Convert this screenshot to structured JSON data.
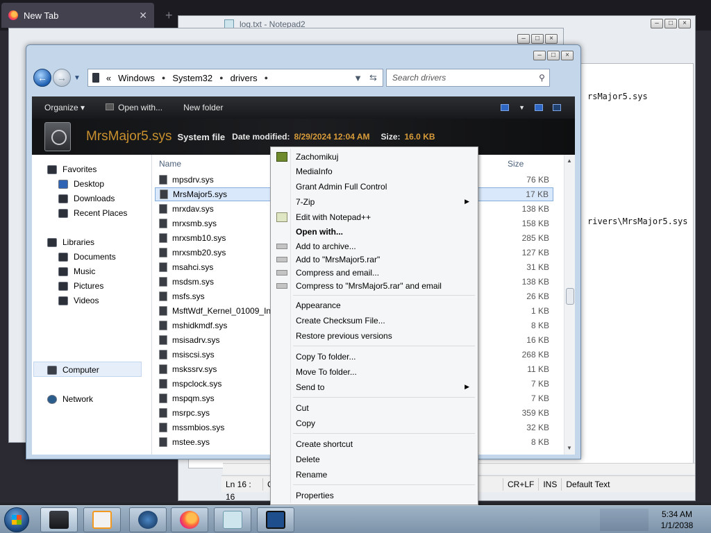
{
  "browser": {
    "tab_title": "New Tab",
    "tab_close": "✕",
    "new_tab": "+"
  },
  "notepad": {
    "title": "log.txt - Notepad2",
    "lines": [
      "rsMajor5.sys",
      "rivers\\MrsMajor5.sys"
    ],
    "status": {
      "position": "Ln 16 : 16",
      "col_partial": "C",
      "eol": "CR+LF",
      "ins": "INS",
      "scheme": "Default Text"
    }
  },
  "explorer": {
    "breadcrumb": [
      "Windows",
      "System32",
      "drivers"
    ],
    "crumb_prefix": "«",
    "search_placeholder": "Search drivers",
    "toolbar": {
      "organize": "Organize",
      "open_with": "Open with...",
      "new_folder": "New folder"
    },
    "details": {
      "filename": "MrsMajor5.sys",
      "filetype": "System file",
      "date_label": "Date modified:",
      "date_value": "8/29/2024 12:04 AM",
      "size_label": "Size:",
      "size_value": "16.0 KB"
    },
    "nav": {
      "favorites": "Favorites",
      "desktop": "Desktop",
      "downloads": "Downloads",
      "recent_places": "Recent Places",
      "libraries": "Libraries",
      "documents": "Documents",
      "music": "Music",
      "pictures": "Pictures",
      "videos": "Videos",
      "computer": "Computer",
      "network": "Network"
    },
    "columns": {
      "name": "Name",
      "size": "Size"
    },
    "files": [
      {
        "name": "mpsdrv.sys",
        "size": "76 KB"
      },
      {
        "name": "MrsMajor5.sys",
        "size": "17 KB"
      },
      {
        "name": "mrxdav.sys",
        "size": "138 KB"
      },
      {
        "name": "mrxsmb.sys",
        "size": "158 KB"
      },
      {
        "name": "mrxsmb10.sys",
        "size": "285 KB"
      },
      {
        "name": "mrxsmb20.sys",
        "size": "127 KB"
      },
      {
        "name": "msahci.sys",
        "size": "31 KB"
      },
      {
        "name": "msdsm.sys",
        "size": "138 KB"
      },
      {
        "name": "msfs.sys",
        "size": "26 KB"
      },
      {
        "name": "MsftWdf_Kernel_01009_Inbc",
        "size": "1 KB"
      },
      {
        "name": "mshidkmdf.sys",
        "size": "8 KB"
      },
      {
        "name": "msisadrv.sys",
        "size": "16 KB"
      },
      {
        "name": "msiscsi.sys",
        "size": "268 KB"
      },
      {
        "name": "mskssrv.sys",
        "size": "11 KB"
      },
      {
        "name": "mspclock.sys",
        "size": "7 KB"
      },
      {
        "name": "mspqm.sys",
        "size": "7 KB"
      },
      {
        "name": "msrpc.sys",
        "size": "359 KB"
      },
      {
        "name": "mssmbios.sys",
        "size": "32 KB"
      },
      {
        "name": "mstee.sys",
        "size": "8 KB"
      }
    ]
  },
  "context_menu": {
    "zachomikuj": "Zachomikuj",
    "mediainfo": "MediaInfo",
    "grant_admin": "Grant Admin Full Control",
    "sevenzip": "7-Zip",
    "edit_npp": "Edit with Notepad++",
    "open_with": "Open with...",
    "add_archive": "Add to archive...",
    "add_rar": "Add to \"MrsMajor5.rar\"",
    "compress_email": "Compress and email...",
    "compress_rar_email": "Compress to \"MrsMajor5.rar\" and email",
    "appearance": "Appearance",
    "checksum": "Create Checksum File...",
    "restore": "Restore previous versions",
    "copy_to": "Copy To folder...",
    "move_to": "Move To folder...",
    "send_to": "Send to",
    "cut": "Cut",
    "copy": "Copy",
    "create_shortcut": "Create shortcut",
    "delete": "Delete",
    "rename": "Rename",
    "properties": "Properties"
  },
  "taskbar": {
    "time": "5:34 AM",
    "date": "1/1/2038"
  }
}
